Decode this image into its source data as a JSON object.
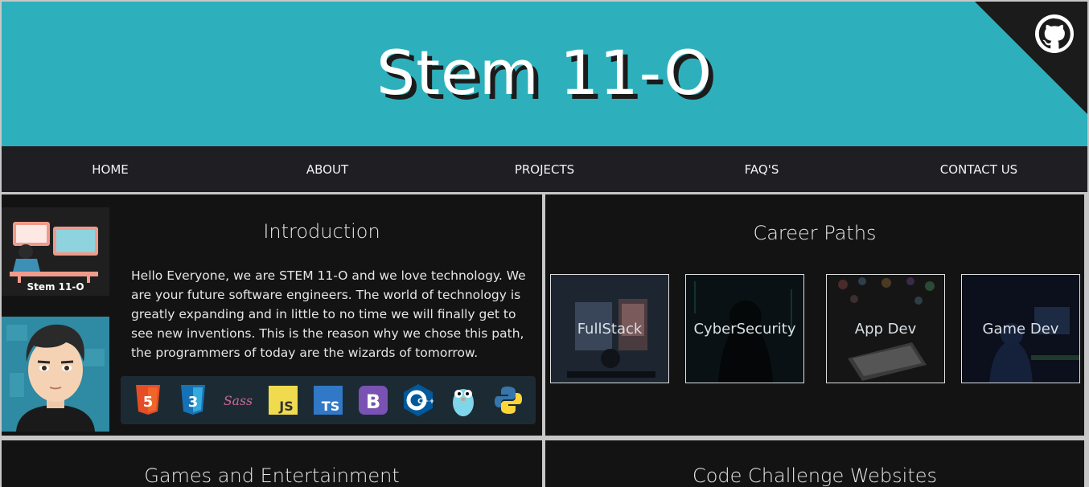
{
  "header": {
    "title": "Stem 11-O",
    "github_icon": "github-icon",
    "colors": {
      "banner": "#2db0bb",
      "corner": "#1b1b1b"
    }
  },
  "nav": {
    "items": [
      "HOME",
      "ABOUT",
      "PROJECTS",
      "FAQ'S",
      "CONTACT US"
    ]
  },
  "intro": {
    "title": "Introduction",
    "logo_caption": "Stem 11-O",
    "text": "Hello Everyone, we are STEM 11-O and we love technology. We are your future software engineers. The world of technology is greatly expanding and in little to no time we will finally get to see new inventions. This is the reason why we chose this path, the programmers of today are the wizards of tomorrow.",
    "tech_icons": [
      "html5-icon",
      "css3-icon",
      "sass-icon",
      "javascript-icon",
      "typescript-icon",
      "bootstrap-icon",
      "cplusplus-icon",
      "golang-gopher-icon",
      "python-icon"
    ],
    "js_label": "JS",
    "ts_label": "TS",
    "bootstrap_label": "B",
    "cpp_label": "C++",
    "sass_label": "Sass"
  },
  "career": {
    "title": "Career Paths",
    "cards": [
      "FullStack",
      "CyberSecurity",
      "App Dev",
      "Game Dev"
    ]
  },
  "games": {
    "title": "Games and Entertainment"
  },
  "code": {
    "title": "Code Challenge Websites"
  }
}
